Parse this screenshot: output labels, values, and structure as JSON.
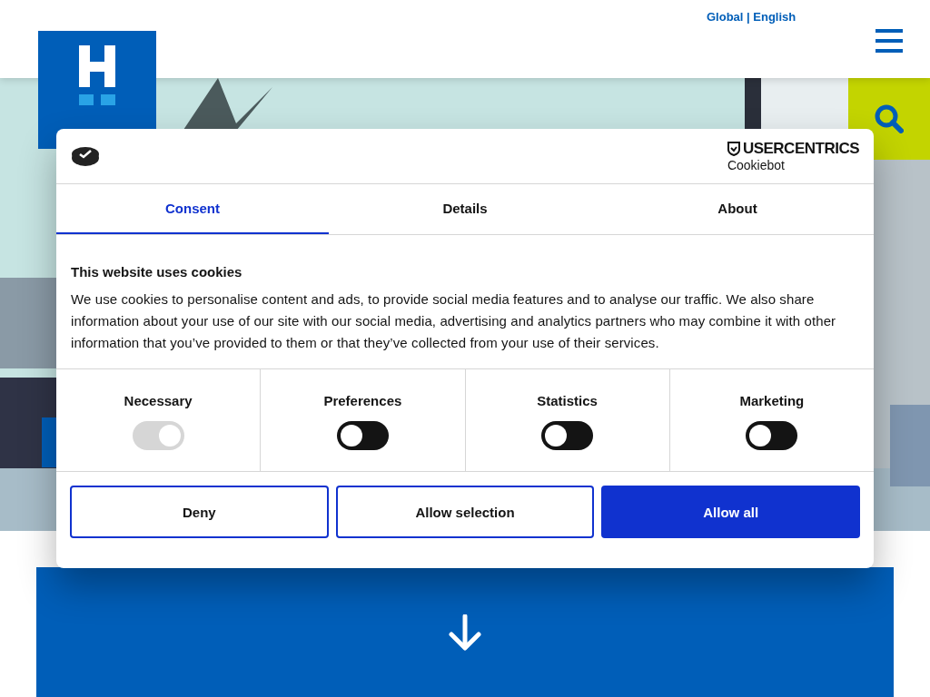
{
  "header": {
    "language": "Global | English"
  },
  "dialog": {
    "brand": "USERCENTRICS",
    "brand_sub": "Cookiebot",
    "tabs": [
      {
        "label": "Consent",
        "selected": true
      },
      {
        "label": "Details",
        "selected": false
      },
      {
        "label": "About",
        "selected": false
      }
    ],
    "heading": "This website uses cookies",
    "body": "We use cookies to personalise content and ads, to provide social media features and to analyse our traffic. We also share information about your use of our site with our social media, advertising and analytics partners who may combine it with other information that you’ve provided to them or that they’ve collected from your use of their services.",
    "categories": [
      {
        "label": "Necessary",
        "checked": true,
        "disabled": true
      },
      {
        "label": "Preferences",
        "checked": false,
        "disabled": false
      },
      {
        "label": "Statistics",
        "checked": false,
        "disabled": false
      },
      {
        "label": "Marketing",
        "checked": false,
        "disabled": false
      }
    ],
    "buttons": [
      {
        "label": "Deny",
        "kind": "outline"
      },
      {
        "label": "Allow selection",
        "kind": "outline"
      },
      {
        "label": "Allow all",
        "kind": "primary"
      }
    ]
  }
}
